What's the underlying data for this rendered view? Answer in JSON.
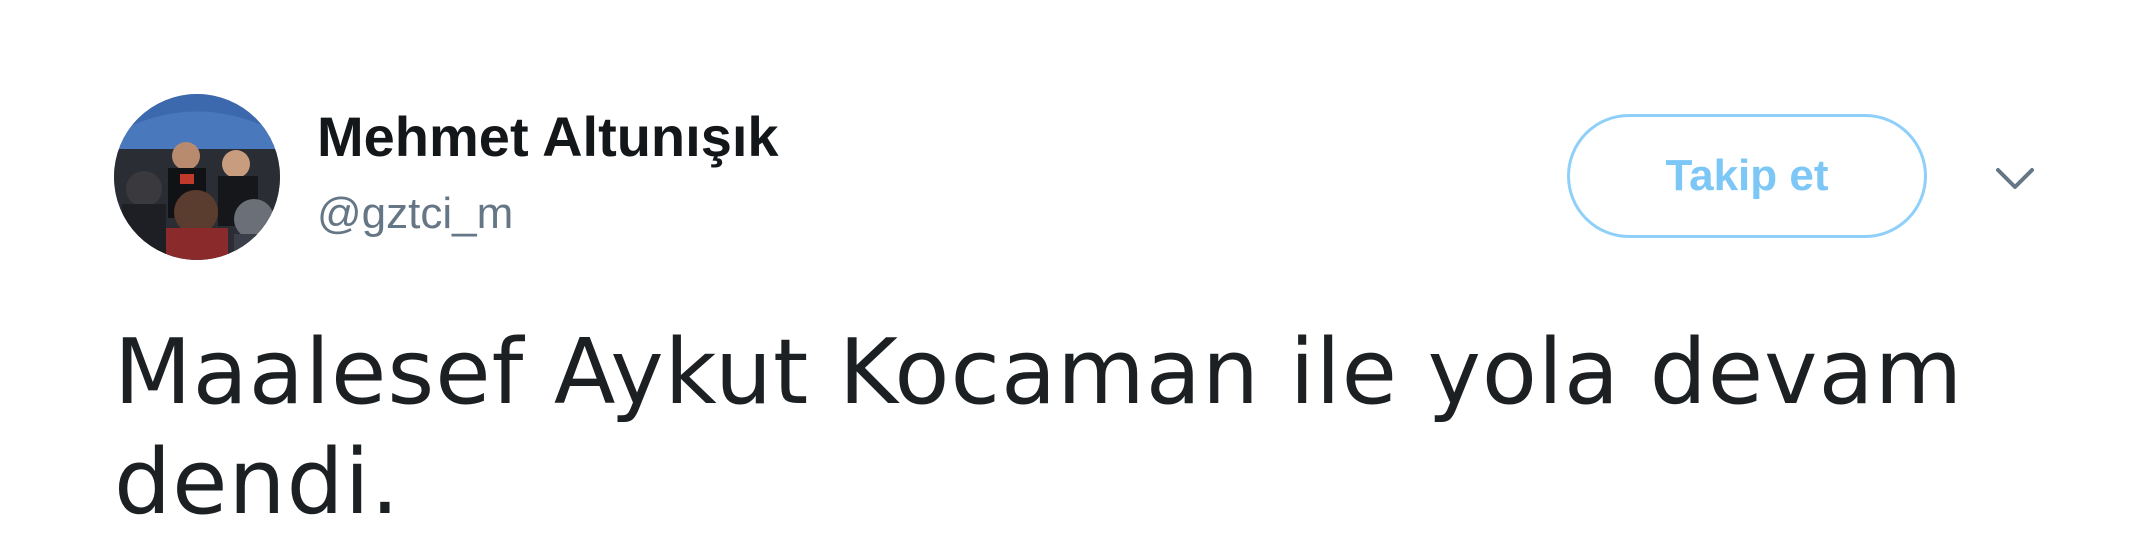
{
  "tweet": {
    "author": {
      "name": "Mehmet Altunışık",
      "handle": "@gztci_m"
    },
    "follow_label": "Takip et",
    "text": "Maalesef Aykut Kocaman ile yola devam dendi.",
    "icons": {
      "avatar": "profile-photo",
      "menu": "chevron-down-icon"
    },
    "colors": {
      "follow_border": "#8ed0f9",
      "follow_text": "#7cc7f5",
      "handle": "#657786",
      "text": "#1c2022"
    }
  }
}
